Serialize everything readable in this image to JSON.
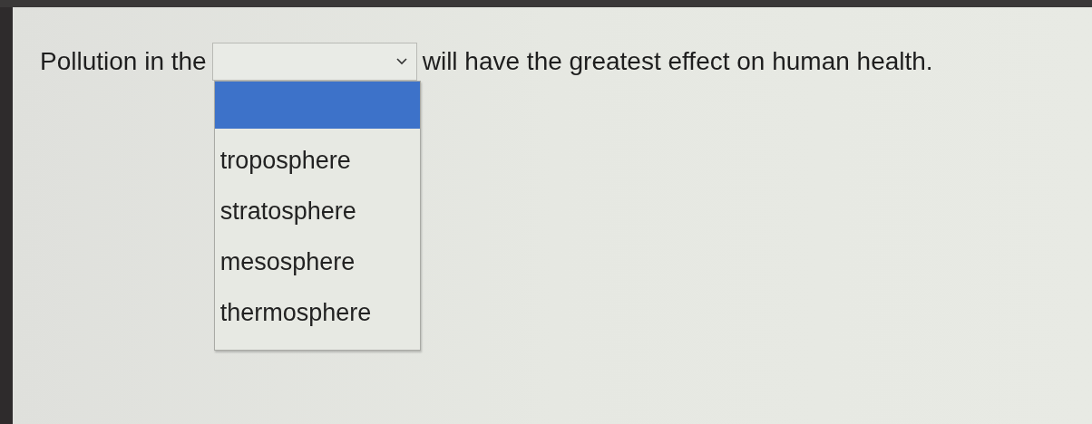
{
  "question": {
    "text_before": "Pollution in the",
    "text_after": "will have the greatest effect on human health."
  },
  "dropdown": {
    "expanded": true,
    "options": [
      {
        "kind": "blank",
        "highlighted": true
      },
      {
        "kind": "text",
        "label": "troposphere",
        "highlighted": false
      },
      {
        "kind": "text",
        "label": "stratosphere",
        "highlighted": false
      },
      {
        "kind": "text",
        "label": "mesosphere",
        "highlighted": false
      },
      {
        "kind": "text",
        "label": "thermosphere",
        "highlighted": false
      }
    ]
  }
}
